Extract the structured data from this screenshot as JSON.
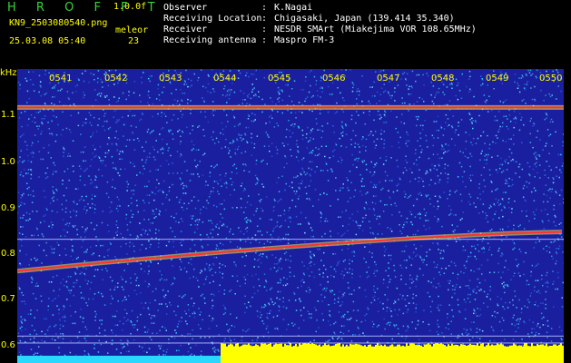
{
  "header": {
    "app_title": "H R O F F T",
    "version": "1.0.0f",
    "filename": "KN9_2503080540.png",
    "mode_label": "meleor",
    "datetime": "25.03.08 05:40",
    "count": "23",
    "info": [
      {
        "key": "Observer",
        "value": "K.Nagai"
      },
      {
        "key": "Receiving Location",
        "value": "Chigasaki, Japan (139.414 35.340)"
      },
      {
        "key": "Receiver",
        "value": "NESDR SMArt (Miakejima VOR 108.65MHz)"
      },
      {
        "key": "Receiving antenna",
        "value": "Maspro FM-3"
      }
    ]
  },
  "spectrogram": {
    "unit_label": "kHz",
    "y_labels": [
      "1.1",
      "1.0",
      "0.9",
      "0.8",
      "0.7",
      "0.6"
    ],
    "time_labels": [
      "0541",
      "0542",
      "0543",
      "0544",
      "0545",
      "0546",
      "0547",
      "0548",
      "0549",
      "0550"
    ],
    "colors": {
      "background": "#1a1fa0",
      "noise_bright": "#3bd4ff",
      "noise_mid": "#2f6cf0",
      "signal": "#ff3030",
      "signal_halo": "#ffff40",
      "floor": "#ffff00",
      "floor_cyan": "#29d8ff"
    },
    "carrier_khz": 1.115,
    "reference_khz": [
      0.83,
      0.62,
      0.605
    ],
    "drift_start_khz": 0.76,
    "drift_end_khz": 0.845
  }
}
